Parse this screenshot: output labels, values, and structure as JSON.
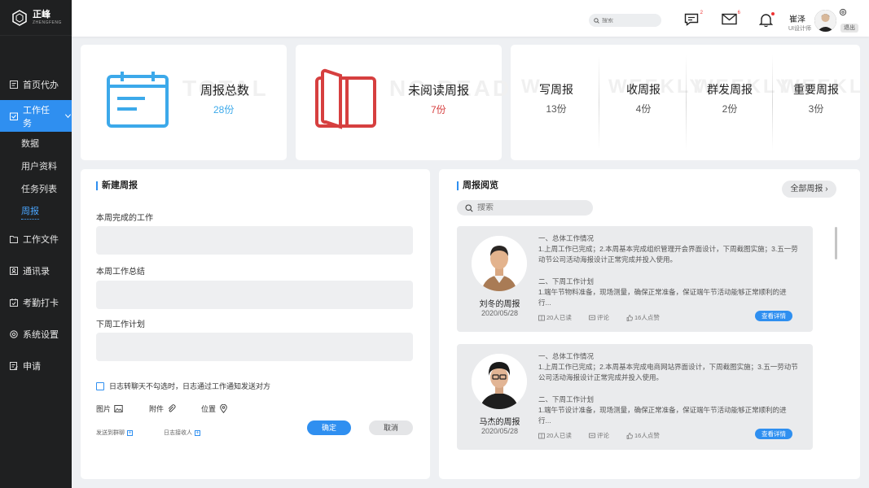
{
  "app": {
    "name": "正峰",
    "sub": "ZHENGFENG"
  },
  "sidebar": {
    "items": [
      {
        "label": "首页代办",
        "icon": "todo-icon"
      },
      {
        "label": "工作任务",
        "icon": "task-icon",
        "active": true
      },
      {
        "label": "工作文件",
        "icon": "folder-icon"
      },
      {
        "label": "通讯录",
        "icon": "contacts-icon"
      },
      {
        "label": "考勤打卡",
        "icon": "calendar-check-icon"
      },
      {
        "label": "系统设置",
        "icon": "gear-icon"
      },
      {
        "label": "申请",
        "icon": "apply-icon"
      }
    ],
    "sub_items": [
      "数据",
      "用户资料",
      "任务列表",
      "周报"
    ],
    "current_sub": "周报"
  },
  "topbar": {
    "search_placeholder": "搜索",
    "message_badge": "2",
    "mail_badge": "6",
    "user_name": "崔泽",
    "user_role": "UI设计师",
    "logout": "退出"
  },
  "stats": {
    "total": {
      "title": "周报总数",
      "value": "28份",
      "watermark": "TOTAL",
      "color": "#3ca9ea"
    },
    "unread": {
      "title": "未阅读周报",
      "value": "7份",
      "watermark": "NO READ",
      "color": "#d63f3f"
    },
    "mini": [
      {
        "title": "写周报",
        "value": "13份",
        "watermark": "W"
      },
      {
        "title": "收周报",
        "value": "4份",
        "watermark": "WEEKLY"
      },
      {
        "title": "群发周报",
        "value": "2份",
        "watermark": "WEEKLY"
      },
      {
        "title": "重要周报",
        "value": "3份",
        "watermark": "WEEKLY"
      }
    ]
  },
  "new_report": {
    "title": "新建周报",
    "done_label": "本周完成的工作",
    "summary_label": "本周工作总结",
    "plan_label": "下周工作计划",
    "checkbox_text": "日志转聊天不勾选时，日志通过工作通知发送对方",
    "attach": {
      "image": "图片",
      "file": "附件",
      "location": "位置"
    },
    "send_group": "发送到群聊",
    "receivers": "日志接收人",
    "confirm": "确定",
    "cancel": "取消"
  },
  "preview": {
    "title": "周报阅览",
    "all_button": "全部周报",
    "search_placeholder": "搜索",
    "reports": [
      {
        "name": "刘冬的周报",
        "date": "2020/05/28",
        "section1": "一、总体工作情况",
        "text1": "1.上周工作已完成；2.本周基本完成组织管理开会界面设计，下周截图实施；3.五一劳动节公司活动海报设计正常完成并投入使用。",
        "section2": "二、下周工作计划",
        "text2": "1.端午节物料准备，现场测量，确保正常准备，保证端午节活动能够正常顺利的进行...",
        "read": "20人已读",
        "comment": "评论",
        "likes": "16人点赞",
        "detail": "查看详情"
      },
      {
        "name": "马杰的周报",
        "date": "2020/05/28",
        "section1": "一、总体工作情况",
        "text1": "1.上周工作已完成；2.本周基本完成电商网站界面设计，下周截图实施；3.五一劳动节公司活动海报设计正常完成并投入使用。",
        "section2": "二、下周工作计划",
        "text2": "1.端午节设计准备，现场测量，确保正常准备，保证端午节活动能够正常顺利的进行...",
        "read": "20人已读",
        "comment": "评论",
        "likes": "16人点赞",
        "detail": "查看详情"
      }
    ]
  }
}
